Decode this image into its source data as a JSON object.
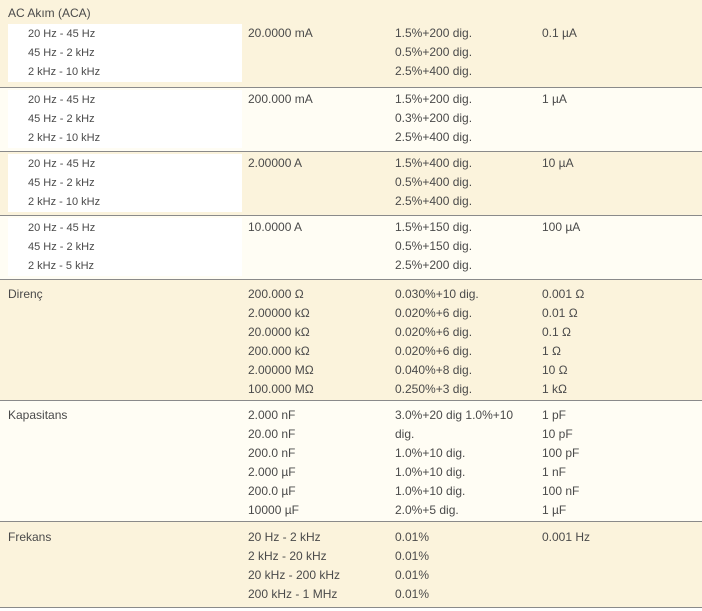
{
  "sections": {
    "ac_akim": {
      "title": "AC Akım (ACA)",
      "groups": [
        {
          "ranges": [
            "20 Hz - 45 Hz",
            "45 Hz - 2 kHz",
            "2 kHz - 10 kHz"
          ],
          "range": "20.0000 mA",
          "accuracy": [
            "1.5%+200 dig.",
            "0.5%+200 dig.",
            "2.5%+400 dig."
          ],
          "resolution": "0.1 µA"
        },
        {
          "ranges": [
            "20 Hz - 45 Hz",
            "45 Hz - 2 kHz",
            "2 kHz - 10 kHz"
          ],
          "range": "200.000 mA",
          "accuracy": [
            "1.5%+200 dig.",
            "0.3%+200 dig.",
            "2.5%+400 dig."
          ],
          "resolution": "1 µA"
        },
        {
          "ranges": [
            "20 Hz - 45 Hz",
            "45 Hz - 2 kHz",
            "2 kHz - 10 kHz"
          ],
          "range": "2.00000 A",
          "accuracy": [
            "1.5%+400 dig.",
            "0.5%+400 dig.",
            "2.5%+400 dig."
          ],
          "resolution": "10 µA"
        },
        {
          "ranges": [
            "20 Hz - 45 Hz",
            "45 Hz - 2 kHz",
            "2 kHz - 5 kHz"
          ],
          "range": "10.0000 A",
          "accuracy": [
            "1.5%+150 dig.",
            "0.5%+150 dig.",
            "2.5%+200 dig."
          ],
          "resolution": "100 µA"
        }
      ]
    },
    "direnc": {
      "title": "Direnç",
      "ranges": [
        "200.000 Ω",
        "2.00000 kΩ",
        "20.0000 kΩ",
        "200.000 kΩ",
        "2.00000 MΩ",
        "100.000 MΩ"
      ],
      "accuracy": [
        "0.030%+10 dig.",
        "0.020%+6 dig.",
        "0.020%+6 dig.",
        "0.020%+6 dig.",
        "0.040%+8 dig.",
        "0.250%+3 dig."
      ],
      "resolution": [
        "0.001 Ω",
        "0.01 Ω",
        "0.1 Ω",
        "1 Ω",
        "10 Ω",
        "1 kΩ"
      ]
    },
    "kapasitans": {
      "title": "Kapasitans",
      "ranges": [
        "2.000 nF",
        "20.00 nF",
        "200.0 nF",
        "2.000 µF",
        "200.0 µF",
        "10000 µF"
      ],
      "accuracy": [
        "3.0%+20 dig 1.0%+10",
        "dig.",
        "1.0%+10 dig.",
        "1.0%+10 dig.",
        "1.0%+10 dig.",
        "2.0%+5 dig."
      ],
      "resolution": [
        "1 pF",
        "10 pF",
        "100 pF",
        "1 nF",
        "100 nF",
        "1 µF"
      ]
    },
    "frekans": {
      "title": "Frekans",
      "ranges": [
        "20 Hz - 2 kHz",
        "2 kHz - 20 kHz",
        "20 kHz - 200 kHz",
        "200 kHz - 1 MHz"
      ],
      "accuracy": [
        "0.01%",
        "0.01%",
        "0.01%",
        "0.01%"
      ],
      "resolution": [
        "0.001 Hz"
      ]
    }
  }
}
